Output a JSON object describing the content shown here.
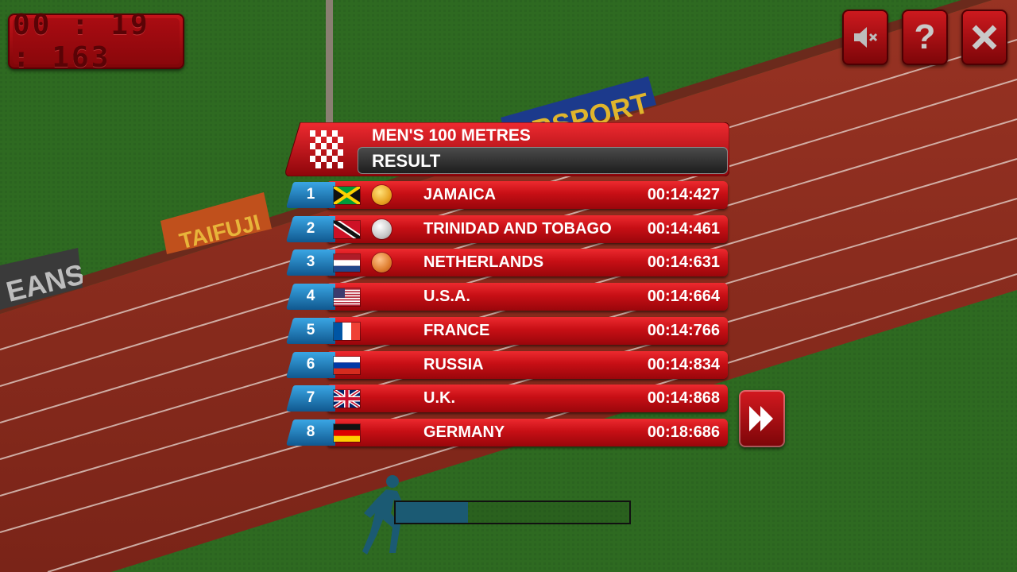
{
  "timer": {
    "text": "00 : 19 : 163"
  },
  "controls": {
    "mute": "mute-icon",
    "help": "?",
    "close": "close-icon"
  },
  "banners": {
    "left": "EANS",
    "middle": "TAIFUJI",
    "top": "RSPORT"
  },
  "results": {
    "event": "MEN'S 100 METRES",
    "label": "RESULT",
    "rows": [
      {
        "rank": "1",
        "country": "JAMAICA",
        "time": "00:14:427",
        "flag": "jamaica",
        "medal": "gold"
      },
      {
        "rank": "2",
        "country": "TRINIDAD AND TOBAGO",
        "time": "00:14:461",
        "flag": "trinidad",
        "medal": "silver"
      },
      {
        "rank": "3",
        "country": "NETHERLANDS",
        "time": "00:14:631",
        "flag": "netherlands",
        "medal": "bronze"
      },
      {
        "rank": "4",
        "country": "U.S.A.",
        "time": "00:14:664",
        "flag": "usa",
        "medal": ""
      },
      {
        "rank": "5",
        "country": "FRANCE",
        "time": "00:14:766",
        "flag": "france",
        "medal": ""
      },
      {
        "rank": "6",
        "country": "RUSSIA",
        "time": "00:14:834",
        "flag": "russia",
        "medal": ""
      },
      {
        "rank": "7",
        "country": "U.K.",
        "time": "00:14:868",
        "flag": "uk",
        "medal": ""
      },
      {
        "rank": "8",
        "country": "GERMANY",
        "time": "00:18:686",
        "flag": "germany",
        "medal": ""
      }
    ]
  },
  "progress": {
    "fraction": 0.31
  },
  "colors": {
    "panel_red": "#c70f15",
    "rank_blue": "#1b7fc1",
    "track": "#8a2a1d",
    "grass": "#2f6b22"
  }
}
